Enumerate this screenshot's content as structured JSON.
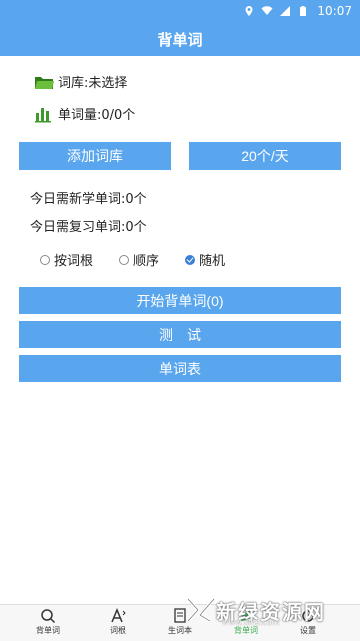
{
  "status": {
    "time": "10:07"
  },
  "app": {
    "title": "背单词"
  },
  "wordbook": {
    "label": "词库:未选择"
  },
  "word_count": {
    "label": "单词量:0/0个"
  },
  "buttons": {
    "add_library": "添加词库",
    "per_day": "20个/天",
    "start": "开始背单词(0)",
    "test": "测　试",
    "word_list": "单词表"
  },
  "stats": {
    "new_today": "今日需新学单词:0个",
    "review_today": "今日需复习单词:0个"
  },
  "order_options": [
    {
      "label": "按词根",
      "checked": false
    },
    {
      "label": "顺序",
      "checked": false
    },
    {
      "label": "随机",
      "checked": true
    }
  ],
  "bottom_nav": [
    {
      "label": "背单词",
      "icon": "search-icon"
    },
    {
      "label": "词根",
      "icon": "font-icon"
    },
    {
      "label": "生词本",
      "icon": "notebook-icon"
    },
    {
      "label": "背单词",
      "icon": "leaf-icon"
    },
    {
      "label": "设置",
      "icon": "gear-icon"
    }
  ],
  "watermark": {
    "text": "新绿资源网",
    "url": "www.xihs.com"
  },
  "colors": {
    "primary": "#5aa6ee",
    "folder": "#4a9a2e"
  }
}
